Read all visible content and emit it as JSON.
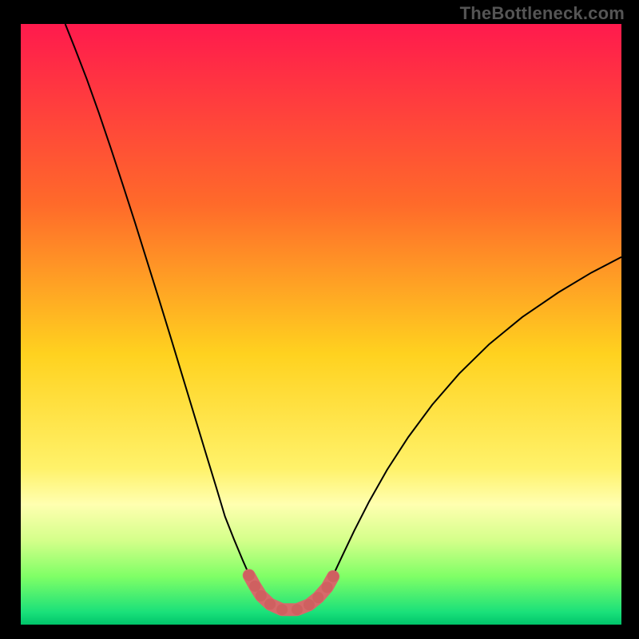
{
  "watermark": "TheBottleneck.com",
  "chart_data": {
    "type": "line",
    "title": "",
    "xlabel": "",
    "ylabel": "",
    "xlim": [
      0,
      1
    ],
    "ylim": [
      0,
      1
    ],
    "grid": false,
    "legend": false,
    "background_gradient": {
      "stops": [
        {
          "offset": 0.0,
          "color": "#ff1a4d"
        },
        {
          "offset": 0.3,
          "color": "#ff6a2a"
        },
        {
          "offset": 0.55,
          "color": "#ffd21f"
        },
        {
          "offset": 0.74,
          "color": "#fff26a"
        },
        {
          "offset": 0.8,
          "color": "#ffffb0"
        },
        {
          "offset": 0.86,
          "color": "#d4ff8a"
        },
        {
          "offset": 0.92,
          "color": "#7fff66"
        },
        {
          "offset": 0.98,
          "color": "#19e07a"
        },
        {
          "offset": 1.0,
          "color": "#00c46a"
        }
      ]
    },
    "series": [
      {
        "name": "left-curve",
        "color": "#000000",
        "width": 2,
        "x": [
          0.074,
          0.09,
          0.11,
          0.13,
          0.15,
          0.17,
          0.19,
          0.21,
          0.23,
          0.25,
          0.27,
          0.29,
          0.31,
          0.325,
          0.34,
          0.355,
          0.37,
          0.378,
          0.386,
          0.394,
          0.399,
          0.404
        ],
        "y": [
          1.0,
          0.96,
          0.908,
          0.852,
          0.793,
          0.732,
          0.67,
          0.606,
          0.542,
          0.477,
          0.411,
          0.345,
          0.279,
          0.23,
          0.18,
          0.142,
          0.106,
          0.088,
          0.072,
          0.058,
          0.051,
          0.046
        ]
      },
      {
        "name": "right-curve",
        "color": "#000000",
        "width": 2,
        "x": [
          0.503,
          0.51,
          0.52,
          0.535,
          0.555,
          0.58,
          0.61,
          0.645,
          0.685,
          0.73,
          0.78,
          0.835,
          0.895,
          0.95,
          1.0
        ],
        "y": [
          0.046,
          0.06,
          0.082,
          0.114,
          0.156,
          0.205,
          0.258,
          0.312,
          0.366,
          0.418,
          0.467,
          0.512,
          0.553,
          0.586,
          0.612
        ]
      },
      {
        "name": "highlight",
        "color": "#d66a6a",
        "width": 16,
        "linecap": "round",
        "x": [
          0.38,
          0.39,
          0.4,
          0.415,
          0.435,
          0.46,
          0.48,
          0.495,
          0.51,
          0.52
        ],
        "y": [
          0.082,
          0.064,
          0.048,
          0.034,
          0.025,
          0.025,
          0.033,
          0.045,
          0.062,
          0.08
        ]
      },
      {
        "name": "highlight-dots",
        "type": "scatter",
        "color": "#cf6060",
        "radius": 7,
        "x": [
          0.38,
          0.39,
          0.4,
          0.415,
          0.435,
          0.46,
          0.48,
          0.495,
          0.51,
          0.52
        ],
        "y": [
          0.082,
          0.064,
          0.048,
          0.034,
          0.025,
          0.025,
          0.033,
          0.045,
          0.062,
          0.08
        ]
      }
    ]
  }
}
